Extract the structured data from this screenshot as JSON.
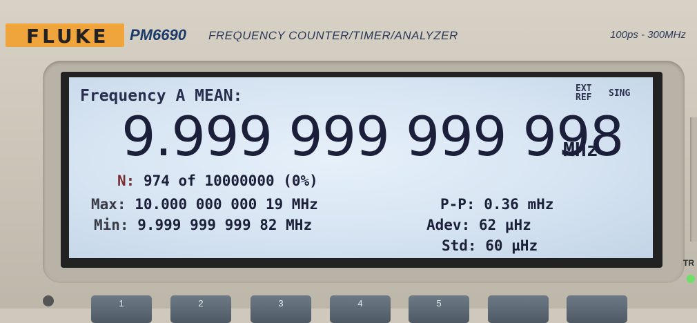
{
  "header": {
    "brand": "FLUKE",
    "model": "PM6690",
    "subtitle": "FREQUENCY COUNTER/TIMER/ANALYZER",
    "range": "100ps - 300MHz"
  },
  "display": {
    "mode": "Frequency A MEAN:",
    "indicators": {
      "ext_ref_line1": "EXT",
      "ext_ref_line2": "REF",
      "sing": "SING"
    },
    "reading": "9.999 999 999 998",
    "unit": "MHz",
    "n_label": "N:",
    "n_value": "974 of 10000000 (0%)",
    "max_label": "Max:",
    "max_value": "10.000 000 000 19 MHz",
    "min_label": "Min:",
    "min_value": "9.999 999 999 82 MHz",
    "pp_label": "P-P:",
    "pp_value": "0.36 mHz",
    "adev_label": "Adev:",
    "adev_value": "62 µHz",
    "std_label": "Std:",
    "std_value": "60 µHz"
  },
  "softkeys": [
    "1",
    "2",
    "3",
    "4",
    "5",
    "",
    ""
  ],
  "side_label": "TR",
  "colors": {
    "lcd_background": "#d6e4f2",
    "lcd_text": "#1b1f3a",
    "brand_orange": "#f0a43c",
    "n_label": "#7a3030"
  }
}
